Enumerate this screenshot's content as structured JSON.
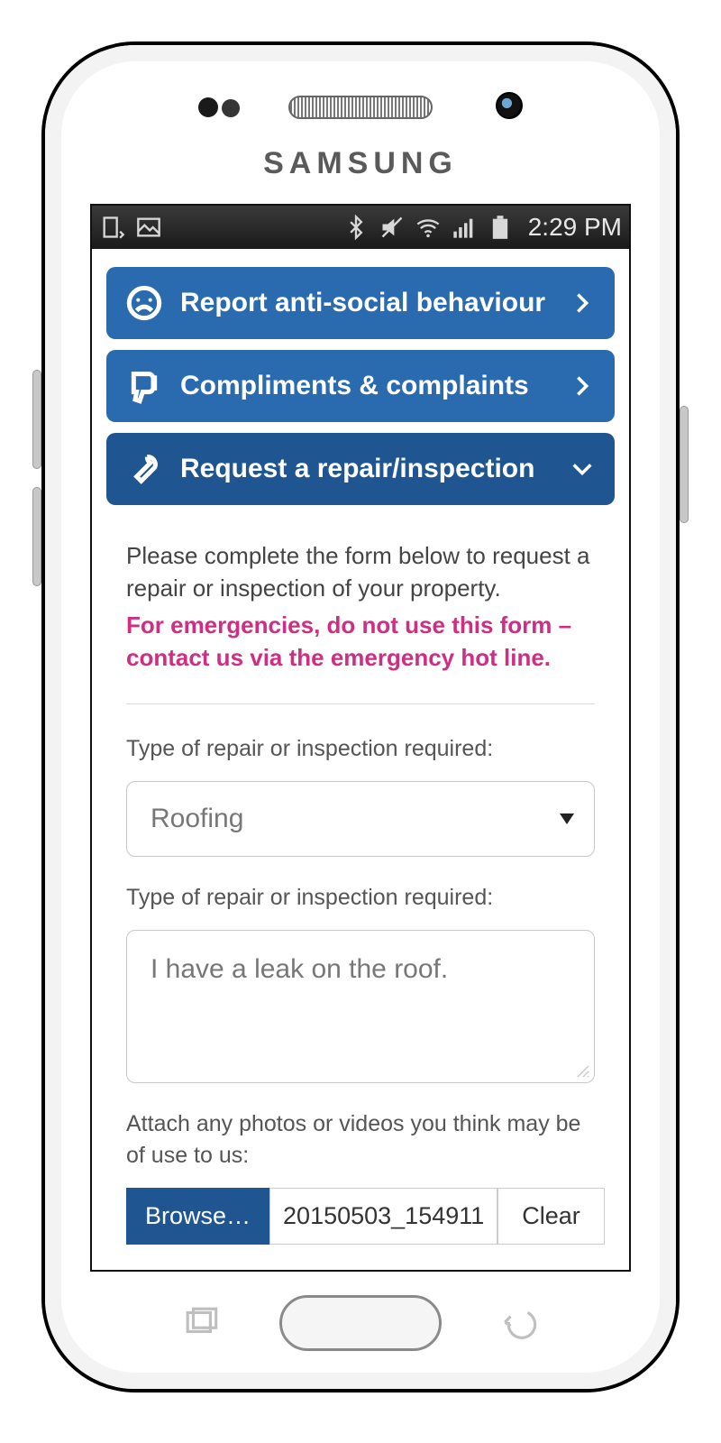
{
  "brand": "SAMSUNG",
  "statusbar": {
    "time": "2:29 PM"
  },
  "accordion": [
    {
      "icon": "frown",
      "label": "Report anti-social behaviour",
      "open": false
    },
    {
      "icon": "thumbs-down",
      "label": "Compliments & complaints",
      "open": false
    },
    {
      "icon": "wrench",
      "label": "Request a repair/inspection",
      "open": true
    }
  ],
  "panel": {
    "instructions": "Please complete the form below to request a repair or inspection of your property.",
    "emergency": "For emergencies, do not use this form – contact us via the emergency hot line.",
    "repair_type": {
      "label": "Type of repair or inspection required:",
      "value": "Roofing"
    },
    "description": {
      "label": "Type of repair or inspection required:",
      "value": "I have a leak on the roof."
    },
    "attach": {
      "label": "Attach any photos or videos you think may be of use to us:",
      "browse": "Browse…",
      "filename": "20150503_154911",
      "clear": "Clear"
    }
  }
}
